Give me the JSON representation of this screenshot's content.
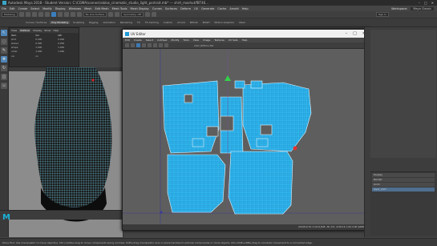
{
  "app": {
    "title": "Autodesk Maya 2018 - Student Version: C:\\CGMA\\scenes\\roblox_cinematic_studio_light_portrait.mb* --- shirt_mashut/fBT46..."
  },
  "menubar": {
    "items": [
      "File",
      "Edit",
      "Create",
      "Select",
      "Modify",
      "Display",
      "Windows",
      "Mesh",
      "Edit Mesh",
      "Mesh Tools",
      "Mesh Display",
      "Curves",
      "Surfaces",
      "Deform",
      "UV",
      "Generate",
      "Cache",
      "Arnold",
      "Help"
    ],
    "right_items": [
      "Workspace:",
      "Maya Classic"
    ]
  },
  "statusline": {
    "mode": "Modeling",
    "no_live": "No Live Surface",
    "symmetry": "Symmetry: Off",
    "sign_in": "Sign In"
  },
  "shelf": {
    "tabs": [
      "Curves / Surfaces",
      "Poly Modeling",
      "Sculpting",
      "Rigging",
      "Animation",
      "Rendering",
      "FX",
      "FX Caching",
      "Custom",
      "Arnold",
      "Bifrost",
      "MASH",
      "Motion Graphics",
      "XGen"
    ]
  },
  "outliner": {
    "tabs": [
      "View",
      "Outliner",
      "Display",
      "Show",
      "Help"
    ],
    "rows": [
      [
        "Item",
        "Val",
        "Attr"
      ],
      [
        "shirt",
        "0.000",
        "0.000"
      ],
      [
        "sleeve",
        "0.000",
        "0.000"
      ],
      [
        "shape",
        "1.000",
        "1.000"
      ],
      [
        "collar",
        "1.000",
        "1.000"
      ],
      [
        "vis",
        "on",
        ""
      ]
    ]
  },
  "uv_editor": {
    "title": "UV Editor",
    "menu": [
      "Edit",
      "Create",
      "Select",
      "Cut/Sew",
      "Modify",
      "Tools",
      "View",
      "Image",
      "Textures",
      "UV Sets",
      "Help"
    ],
    "file_label": "shirt_fbt5mu.fbt",
    "status": "(18,65,0) 54 / 2 shirt_fbt5...f6 / 0.0, -0.00 0.0, 1.00, 0.00 (GRPS_GEO0) 1.00 | -0.000"
  },
  "right": {
    "layers": [
      "Display",
      "Render",
      "Anim",
      "layer_shirt"
    ]
  },
  "helpline": {
    "text": "Move Tool: Use manipulator to move object(s). Ctrl+middle-drag to move components along normals. Shift+drag manipulator axis or plane handles to extrude components or clone objects. Ctrl+Shift+LMB+drag to constrain movement to a connected edge."
  },
  "colors": {
    "uv_shell": "#2fb6f0",
    "uv_bg": "#5e5e5e",
    "mesh_wire": "#6ad9f4",
    "accent": "#1e9ad6"
  },
  "logo_text": "M"
}
